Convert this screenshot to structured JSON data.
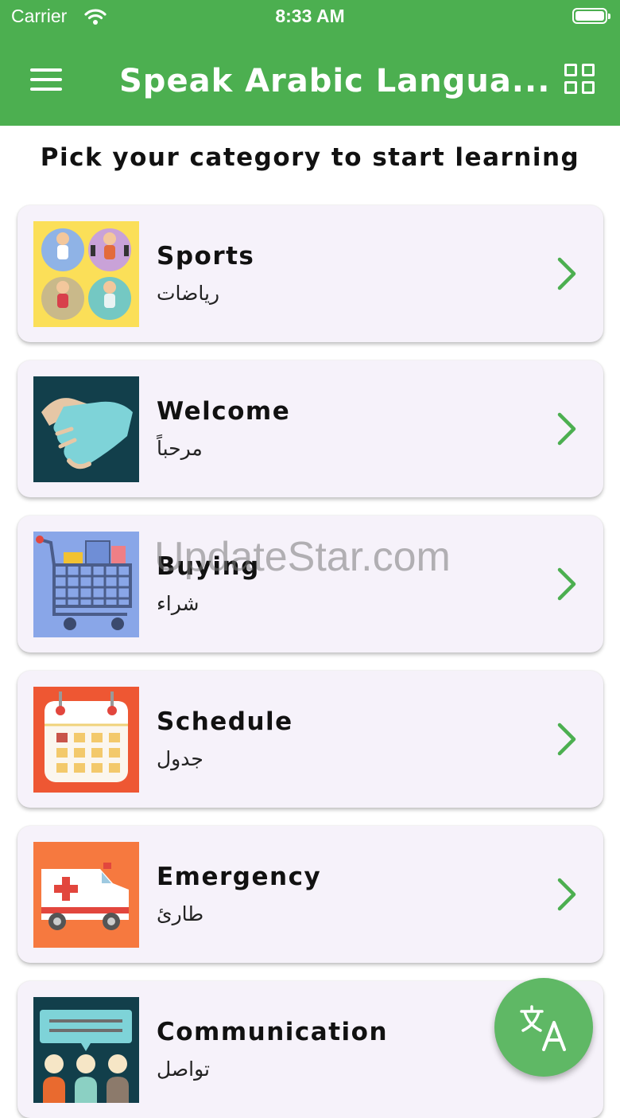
{
  "status_bar": {
    "carrier": "Carrier",
    "time": "8:33 AM"
  },
  "app_bar": {
    "title": "Speak Arabic Langua..."
  },
  "subtitle": "Pick your category to start learning",
  "categories": [
    {
      "name": "Sports",
      "arabic": "رياضات"
    },
    {
      "name": "Welcome",
      "arabic": "مرحباً"
    },
    {
      "name": "Buying",
      "arabic": "شراء"
    },
    {
      "name": "Schedule",
      "arabic": "جدول"
    },
    {
      "name": "Emergency",
      "arabic": "طارئ"
    },
    {
      "name": "Communication",
      "arabic": "تواصل"
    }
  ],
  "watermark": "UpdateStar.com",
  "colors": {
    "primary": "#4caf50",
    "card": "#f6f2fa",
    "chevron": "#4caf50",
    "fab": "#5fb865"
  },
  "icons": [
    "wifi-icon",
    "battery-icon",
    "menu-icon",
    "grid-view-icon",
    "chevron-right-icon",
    "translate-icon"
  ]
}
